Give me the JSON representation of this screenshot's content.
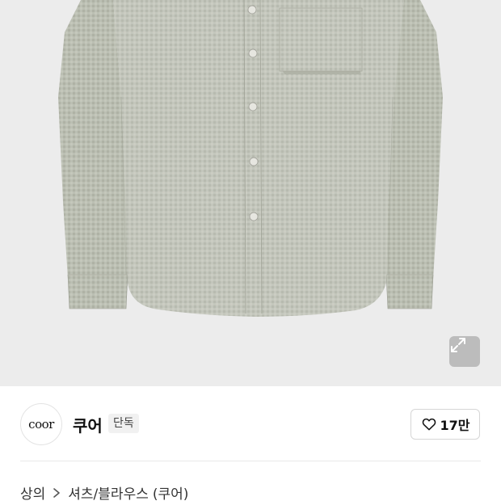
{
  "product": {
    "image_icon": "shirt-product-photo",
    "expand_icon": "expand-icon"
  },
  "brand": {
    "logo_text": "coor",
    "name": "쿠어",
    "badge": "단독"
  },
  "like": {
    "icon": "heart-icon",
    "count": "17만"
  },
  "breadcrumb": {
    "category": "상의",
    "separator_icon": "chevron-right-icon",
    "subcategory": "셔츠/블라우스",
    "brand_suffix": "(쿠어)"
  }
}
